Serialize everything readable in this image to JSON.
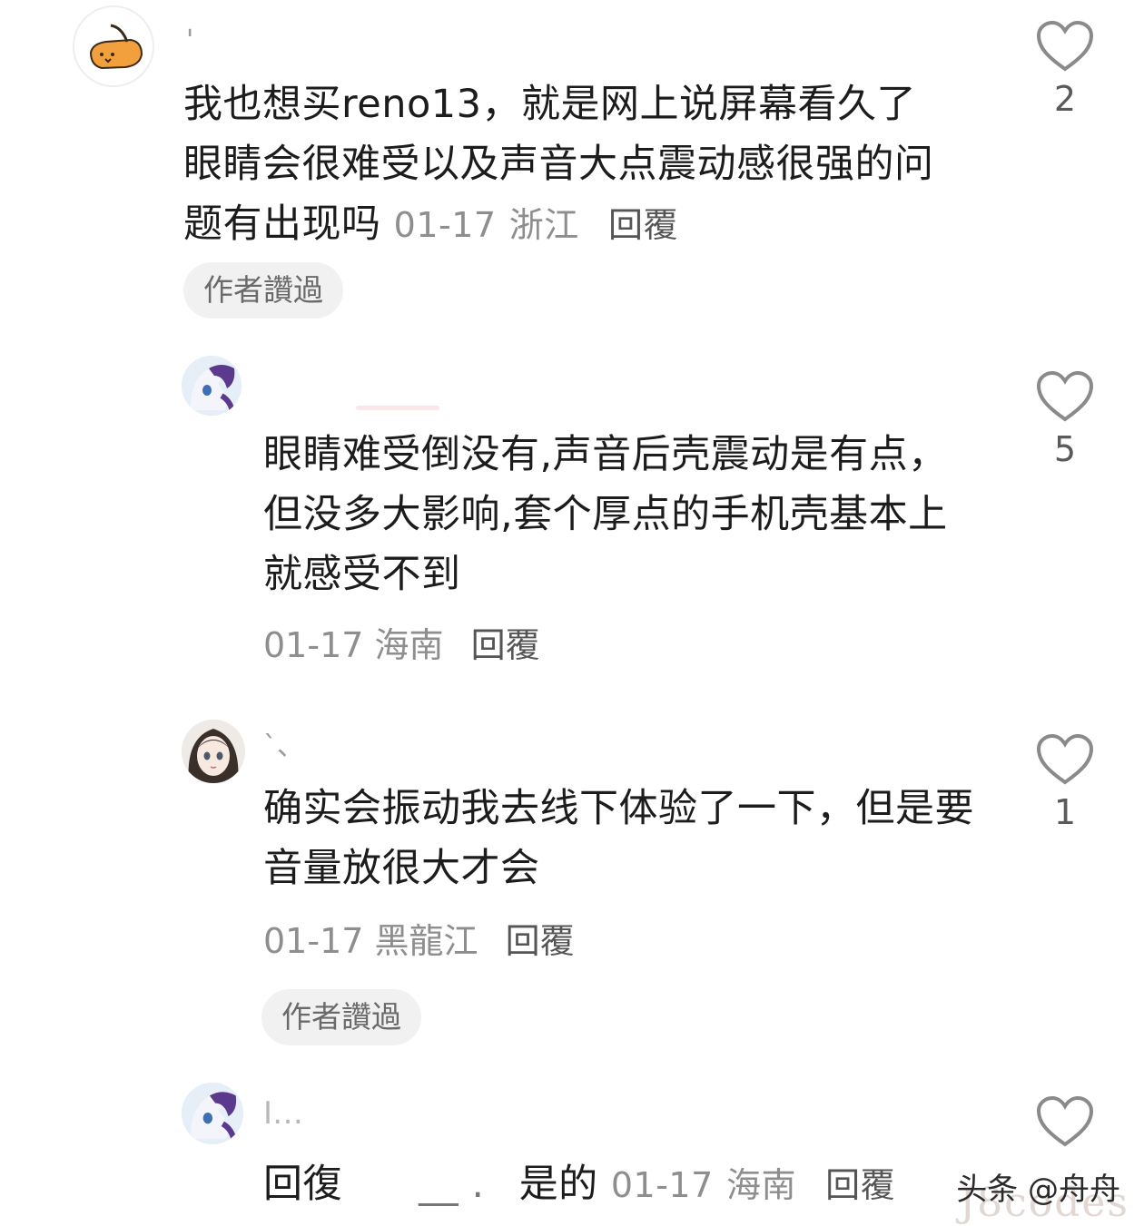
{
  "comments": [
    {
      "username": "'",
      "text": "我也想买reno13，就是网上说屏幕看久了眼睛会很难受以及声音大点震动感很强的问题有出现吗",
      "date": "01-17",
      "location": "浙江",
      "reply_label": "回覆",
      "author_badge": "作者讚過",
      "likes": "2",
      "avatar": "cartoon-cat-avatar"
    },
    {
      "username": "",
      "text": "眼睛难受倒没有,声音后壳震动是有点，但没多大影响,套个厚点的手机壳基本上就感受不到",
      "date": "01-17",
      "location": "海南",
      "reply_label": "回覆",
      "likes": "5",
      "avatar": "pony-avatar"
    },
    {
      "username": "`、",
      "text": "确实会振动我去线下体验了一下，但是要音量放很大才会",
      "date": "01-17",
      "location": "黑龍江",
      "reply_label": "回覆",
      "author_badge": "作者讚過",
      "likes": "1",
      "avatar": "anime-girl-avatar"
    },
    {
      "username": "I…",
      "reply_prefix": "回復",
      "mention": "__ .",
      "text": "是的",
      "date": "01-17",
      "location": "海南",
      "reply_label": "回覆",
      "likes": "",
      "avatar": "pony-avatar"
    }
  ],
  "watermark": "头条 @舟舟",
  "site_mark": "J8codes",
  "colors": {
    "meta": "#8e8e8e",
    "badge_bg": "#f1f1f1",
    "heart": "#8a8a8a"
  },
  "icons": {
    "like": "heart-outline-icon"
  }
}
